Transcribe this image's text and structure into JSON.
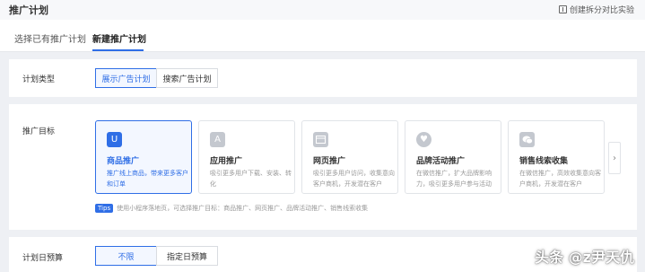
{
  "header": {
    "title": "推广计划",
    "ab_test_label": "创建拆分对比实验",
    "ab_test_icon": "split-test-icon"
  },
  "tabs": [
    {
      "label": "选择已有推广计划",
      "active": false
    },
    {
      "label": "新建推广计划",
      "active": true
    }
  ],
  "plan_type": {
    "label": "计划类型",
    "options": [
      "展示广告计划",
      "搜索广告计划"
    ],
    "selected": "展示广告计划"
  },
  "goal": {
    "label": "推广目标",
    "cards": [
      {
        "title": "商品推广",
        "desc": "推广线上商品，带来更多客户和订单",
        "icon": "shopping-bag-icon",
        "selected": true
      },
      {
        "title": "应用推广",
        "desc": "吸引更多用户下载、安装、转化",
        "icon": "app-store-icon",
        "selected": false
      },
      {
        "title": "网页推广",
        "desc": "吸引更多用户访问，收集意向客户商机，开发潜在客户",
        "icon": "browser-window-icon",
        "selected": false
      },
      {
        "title": "品牌活动推广",
        "desc": "在微信推广，扩大品牌影响力，吸引更多用户参与活动",
        "icon": "heart-chat-icon",
        "selected": false
      },
      {
        "title": "销售线索收集",
        "desc": "在微信推广，高效收集意向客户商机，开发潜在客户",
        "icon": "chat-bubbles-icon",
        "selected": false
      }
    ],
    "next_icon": "chevron-right-icon",
    "tips_badge": "Tips",
    "tips_text": "使用小程序落地页，可选择推广目标：商品推广、网页推广、品牌活动推广、销售线索收集"
  },
  "budget": {
    "label": "计划日预算",
    "options": [
      "不限",
      "指定日预算"
    ],
    "selected": "不限"
  },
  "watermark": "头条 @z尹天仇",
  "colors": {
    "accent": "#2f6ee6",
    "page_bg": "#eef0f4"
  }
}
